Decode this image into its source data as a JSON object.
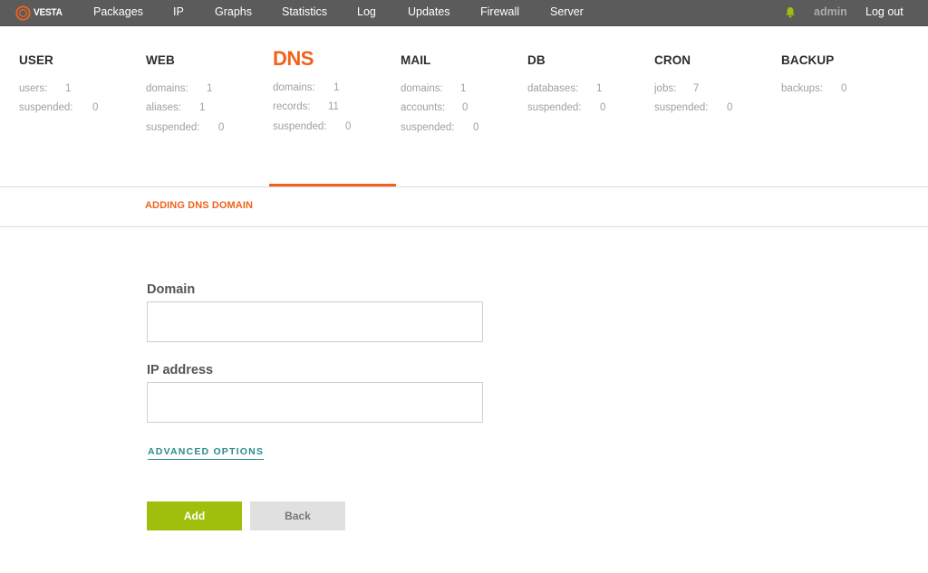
{
  "app": {
    "logo_text": "VESTA",
    "nav": [
      "Packages",
      "IP",
      "Graphs",
      "Statistics",
      "Log",
      "Updates",
      "Firewall",
      "Server"
    ],
    "user": "admin",
    "logout_label": "Log out"
  },
  "stats": [
    {
      "title": "USER",
      "rows": [
        {
          "label": "users:",
          "value": "1"
        },
        {
          "label": "suspended:",
          "value": "0"
        }
      ]
    },
    {
      "title": "WEB",
      "rows": [
        {
          "label": "domains:",
          "value": "1"
        },
        {
          "label": "aliases:",
          "value": "1"
        },
        {
          "label": "suspended:",
          "value": "0"
        }
      ]
    },
    {
      "title": "DNS",
      "rows": [
        {
          "label": "domains:",
          "value": "1"
        },
        {
          "label": "records:",
          "value": "11"
        },
        {
          "label": "suspended:",
          "value": "0"
        }
      ]
    },
    {
      "title": "MAIL",
      "rows": [
        {
          "label": "domains:",
          "value": "1"
        },
        {
          "label": "accounts:",
          "value": "0"
        },
        {
          "label": "suspended:",
          "value": "0"
        }
      ]
    },
    {
      "title": "DB",
      "rows": [
        {
          "label": "databases:",
          "value": "1"
        },
        {
          "label": "suspended:",
          "value": "0"
        }
      ]
    },
    {
      "title": "CRON",
      "rows": [
        {
          "label": "jobs:",
          "value": "7"
        },
        {
          "label": "suspended:",
          "value": "0"
        }
      ]
    },
    {
      "title": "BACKUP",
      "rows": [
        {
          "label": "backups:",
          "value": "0"
        }
      ]
    }
  ],
  "active_section": "DNS",
  "form": {
    "title": "ADDING DNS DOMAIN",
    "domain_label": "Domain",
    "domain_value": "",
    "ip_label": "IP address",
    "ip_value": "",
    "advanced_label": "ADVANCED OPTIONS",
    "add_label": "Add",
    "back_label": "Back"
  },
  "colors": {
    "accent": "#f0621c",
    "add_button": "#9fbf0c",
    "link": "#2c8a8a",
    "topbar": "#5b5b5b"
  },
  "icons": [
    "vesta-logo-icon",
    "bell-icon"
  ]
}
